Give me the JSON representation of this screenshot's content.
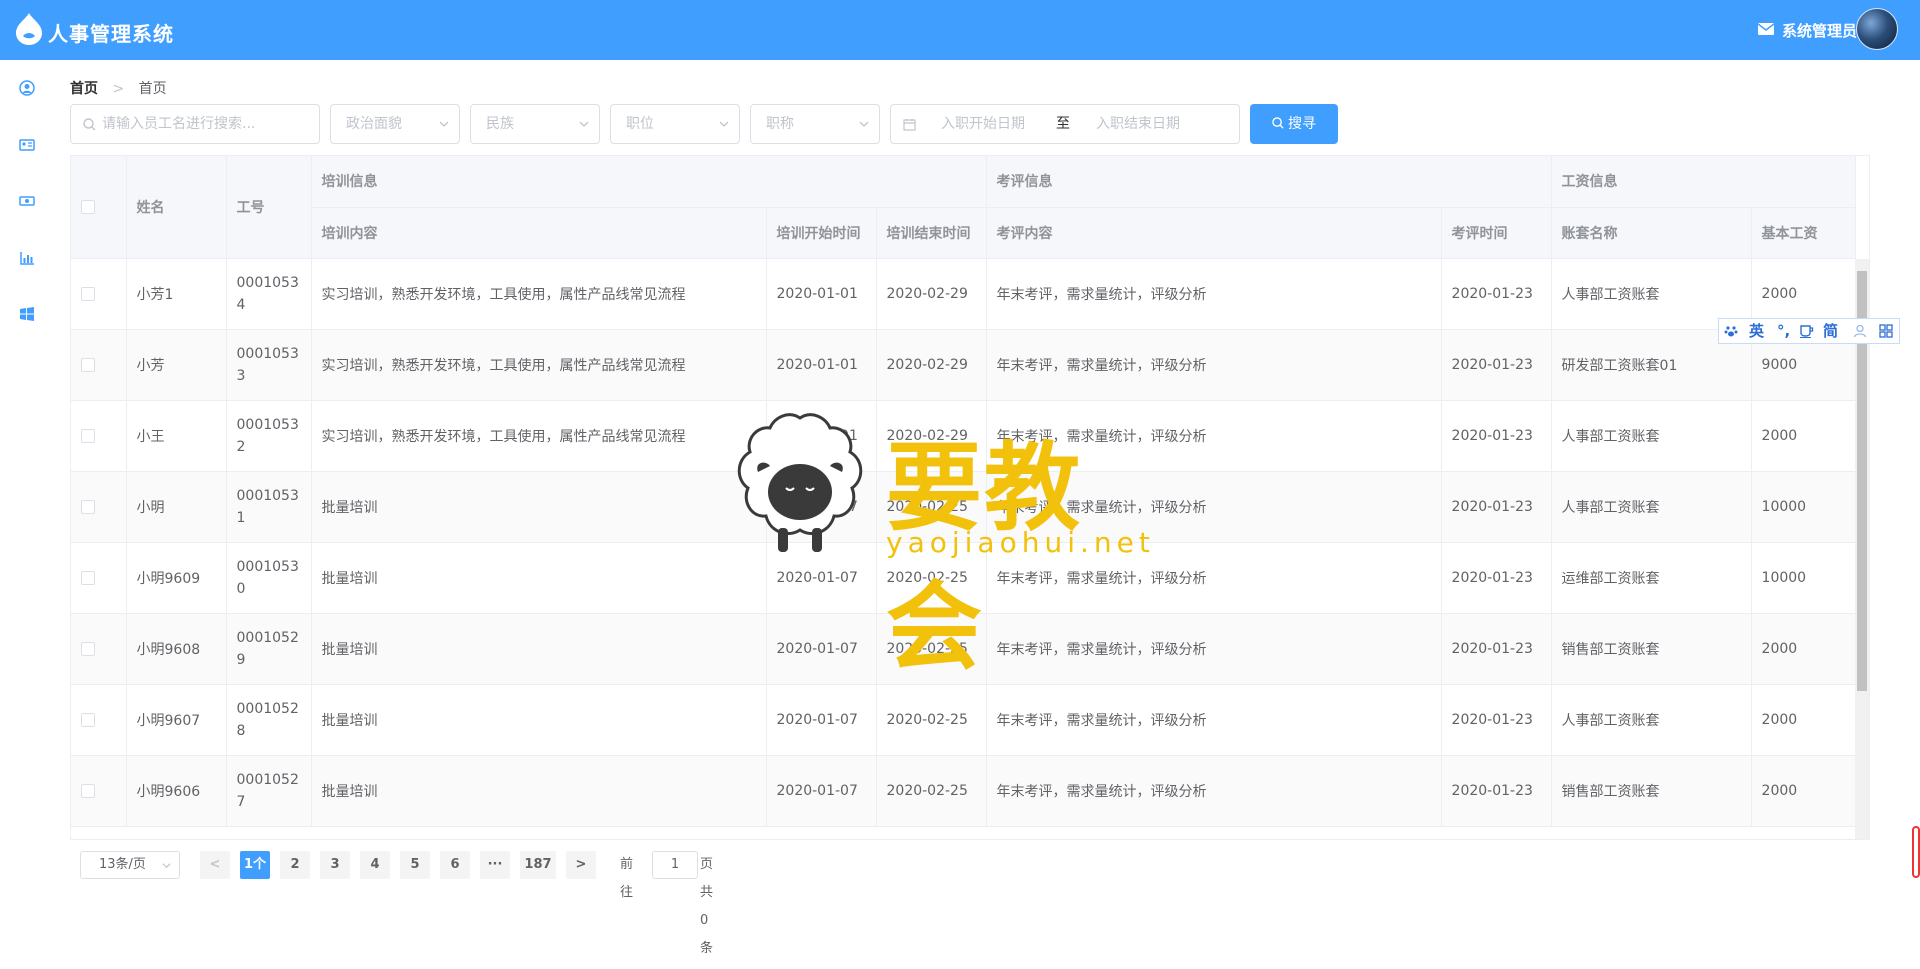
{
  "app": {
    "title": "人事管理系统",
    "user_name": "系统管理员",
    "accent": "#409eff"
  },
  "sidebar": {
    "items": [
      "user-circle-icon",
      "id-card-icon",
      "money-icon",
      "bar-chart-icon",
      "windows-icon"
    ]
  },
  "breadcrumb": {
    "home": "首页",
    "current": "首页"
  },
  "filters": {
    "search_placeholder": "请输入员工名进行搜索...",
    "politic": "政治面貌",
    "nation": "民族",
    "position": "职位",
    "title": "职称",
    "start_date": "入职开始日期",
    "to": "至",
    "end_date": "入职结束日期",
    "search_button": "搜寻"
  },
  "table": {
    "groups": {
      "training": "培训信息",
      "appraisal": "考评信息",
      "salary": "工资信息"
    },
    "headers": {
      "name": "姓名",
      "work_id": "工号",
      "train_content": "培训内容",
      "train_start": "培训开始时间",
      "train_end": "培训结束时间",
      "appraisal_content": "考评内容",
      "appraisal_date": "考评时间",
      "salary_set": "账套名称",
      "base_salary": "基本工资"
    },
    "rows": [
      {
        "name": "小芳1",
        "work_id": "00010534",
        "train_content": "实习培训，熟悉开发环境，工具使用，属性产品线常见流程",
        "train_start": "2020-01-01",
        "train_end": "2020-02-29",
        "appraisal_content": "年末考评，需求量统计，评级分析",
        "appraisal_date": "2020-01-23",
        "salary_set": "人事部工资账套",
        "base_salary": "2000"
      },
      {
        "name": "小芳",
        "work_id": "00010533",
        "train_content": "实习培训，熟悉开发环境，工具使用，属性产品线常见流程",
        "train_start": "2020-01-01",
        "train_end": "2020-02-29",
        "appraisal_content": "年末考评，需求量统计，评级分析",
        "appraisal_date": "2020-01-23",
        "salary_set": "研发部工资账套01",
        "base_salary": "9000"
      },
      {
        "name": "小王",
        "work_id": "00010532",
        "train_content": "实习培训，熟悉开发环境，工具使用，属性产品线常见流程",
        "train_start": "2020-01-01",
        "train_end": "2020-02-29",
        "appraisal_content": "年末考评，需求量统计，评级分析",
        "appraisal_date": "2020-01-23",
        "salary_set": "人事部工资账套",
        "base_salary": "2000"
      },
      {
        "name": "小明",
        "work_id": "00010531",
        "train_content": "批量培训",
        "train_start": "2020-01-07",
        "train_end": "2020-02-25",
        "appraisal_content": "年末考评，需求量统计，评级分析",
        "appraisal_date": "2020-01-23",
        "salary_set": "人事部工资账套",
        "base_salary": "10000"
      },
      {
        "name": "小明9609",
        "work_id": "00010530",
        "train_content": "批量培训",
        "train_start": "2020-01-07",
        "train_end": "2020-02-25",
        "appraisal_content": "年末考评，需求量统计，评级分析",
        "appraisal_date": "2020-01-23",
        "salary_set": "运维部工资账套",
        "base_salary": "10000"
      },
      {
        "name": "小明9608",
        "work_id": "00010529",
        "train_content": "批量培训",
        "train_start": "2020-01-07",
        "train_end": "2020-02-25",
        "appraisal_content": "年末考评，需求量统计，评级分析",
        "appraisal_date": "2020-01-23",
        "salary_set": "销售部工资账套",
        "base_salary": "2000"
      },
      {
        "name": "小明9607",
        "work_id": "00010528",
        "train_content": "批量培训",
        "train_start": "2020-01-07",
        "train_end": "2020-02-25",
        "appraisal_content": "年末考评，需求量统计，评级分析",
        "appraisal_date": "2020-01-23",
        "salary_set": "人事部工资账套",
        "base_salary": "2000"
      },
      {
        "name": "小明9606",
        "work_id": "00010527",
        "train_content": "批量培训",
        "train_start": "2020-01-07",
        "train_end": "2020-02-25",
        "appraisal_content": "年末考评，需求量统计，评级分析",
        "appraisal_date": "2020-01-23",
        "salary_set": "销售部工资账套",
        "base_salary": "2000"
      }
    ]
  },
  "ime": {
    "english": "英",
    "punct": "°,",
    "simplified": "简"
  },
  "watermark": {
    "text": "要教会",
    "url": "yaojiaohui.net"
  },
  "pagination": {
    "page_size": "13条/页",
    "pages": [
      "1个",
      "2",
      "3",
      "4",
      "5",
      "6",
      "···",
      "187"
    ],
    "goto_label": "前往",
    "goto_value": "1",
    "total": "页共0条"
  }
}
